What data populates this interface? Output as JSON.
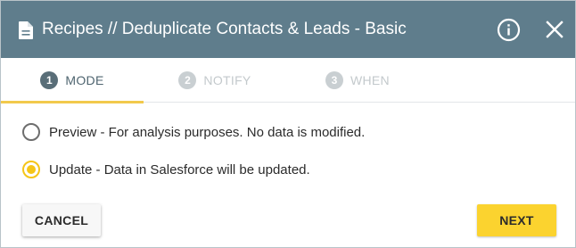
{
  "dialog": {
    "title": "Recipes // Deduplicate Contacts & Leads - Basic",
    "title_icon": "document-icon",
    "info_icon": "info-icon",
    "close_icon": "close-icon"
  },
  "tabs": [
    {
      "number": "1",
      "label": "MODE",
      "active": true
    },
    {
      "number": "2",
      "label": "NOTIFY",
      "active": false
    },
    {
      "number": "3",
      "label": "WHEN",
      "active": false
    }
  ],
  "options": [
    {
      "label": "Preview - For analysis purposes. No data is modified.",
      "selected": false
    },
    {
      "label": "Update - Data in Salesforce will be updated.",
      "selected": true
    }
  ],
  "buttons": {
    "cancel_label": "CANCEL",
    "next_label": "NEXT"
  },
  "colors": {
    "titlebar": "#5f7d8c",
    "accent": "#f5c518",
    "next_button": "#fbd32f"
  }
}
